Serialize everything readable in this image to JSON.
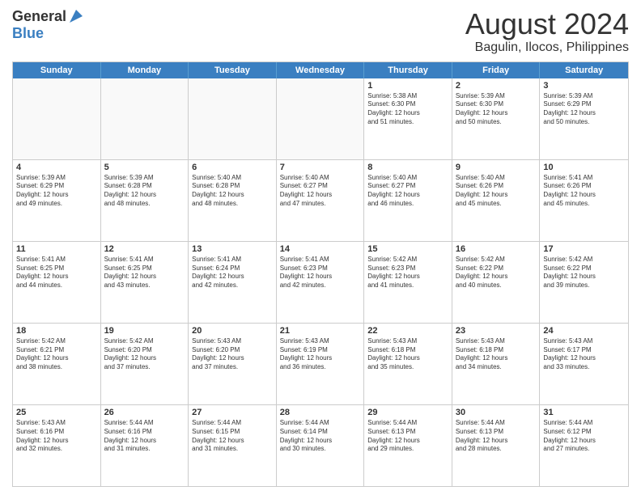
{
  "logo": {
    "line1": "General",
    "line2": "Blue"
  },
  "title": "August 2024",
  "subtitle": "Bagulin, Ilocos, Philippines",
  "days": [
    "Sunday",
    "Monday",
    "Tuesday",
    "Wednesday",
    "Thursday",
    "Friday",
    "Saturday"
  ],
  "weeks": [
    [
      {
        "day": "",
        "text": ""
      },
      {
        "day": "",
        "text": ""
      },
      {
        "day": "",
        "text": ""
      },
      {
        "day": "",
        "text": ""
      },
      {
        "day": "1",
        "text": "Sunrise: 5:38 AM\nSunset: 6:30 PM\nDaylight: 12 hours\nand 51 minutes."
      },
      {
        "day": "2",
        "text": "Sunrise: 5:39 AM\nSunset: 6:30 PM\nDaylight: 12 hours\nand 50 minutes."
      },
      {
        "day": "3",
        "text": "Sunrise: 5:39 AM\nSunset: 6:29 PM\nDaylight: 12 hours\nand 50 minutes."
      }
    ],
    [
      {
        "day": "4",
        "text": "Sunrise: 5:39 AM\nSunset: 6:29 PM\nDaylight: 12 hours\nand 49 minutes."
      },
      {
        "day": "5",
        "text": "Sunrise: 5:39 AM\nSunset: 6:28 PM\nDaylight: 12 hours\nand 48 minutes."
      },
      {
        "day": "6",
        "text": "Sunrise: 5:40 AM\nSunset: 6:28 PM\nDaylight: 12 hours\nand 48 minutes."
      },
      {
        "day": "7",
        "text": "Sunrise: 5:40 AM\nSunset: 6:27 PM\nDaylight: 12 hours\nand 47 minutes."
      },
      {
        "day": "8",
        "text": "Sunrise: 5:40 AM\nSunset: 6:27 PM\nDaylight: 12 hours\nand 46 minutes."
      },
      {
        "day": "9",
        "text": "Sunrise: 5:40 AM\nSunset: 6:26 PM\nDaylight: 12 hours\nand 45 minutes."
      },
      {
        "day": "10",
        "text": "Sunrise: 5:41 AM\nSunset: 6:26 PM\nDaylight: 12 hours\nand 45 minutes."
      }
    ],
    [
      {
        "day": "11",
        "text": "Sunrise: 5:41 AM\nSunset: 6:25 PM\nDaylight: 12 hours\nand 44 minutes."
      },
      {
        "day": "12",
        "text": "Sunrise: 5:41 AM\nSunset: 6:25 PM\nDaylight: 12 hours\nand 43 minutes."
      },
      {
        "day": "13",
        "text": "Sunrise: 5:41 AM\nSunset: 6:24 PM\nDaylight: 12 hours\nand 42 minutes."
      },
      {
        "day": "14",
        "text": "Sunrise: 5:41 AM\nSunset: 6:23 PM\nDaylight: 12 hours\nand 42 minutes."
      },
      {
        "day": "15",
        "text": "Sunrise: 5:42 AM\nSunset: 6:23 PM\nDaylight: 12 hours\nand 41 minutes."
      },
      {
        "day": "16",
        "text": "Sunrise: 5:42 AM\nSunset: 6:22 PM\nDaylight: 12 hours\nand 40 minutes."
      },
      {
        "day": "17",
        "text": "Sunrise: 5:42 AM\nSunset: 6:22 PM\nDaylight: 12 hours\nand 39 minutes."
      }
    ],
    [
      {
        "day": "18",
        "text": "Sunrise: 5:42 AM\nSunset: 6:21 PM\nDaylight: 12 hours\nand 38 minutes."
      },
      {
        "day": "19",
        "text": "Sunrise: 5:42 AM\nSunset: 6:20 PM\nDaylight: 12 hours\nand 37 minutes."
      },
      {
        "day": "20",
        "text": "Sunrise: 5:43 AM\nSunset: 6:20 PM\nDaylight: 12 hours\nand 37 minutes."
      },
      {
        "day": "21",
        "text": "Sunrise: 5:43 AM\nSunset: 6:19 PM\nDaylight: 12 hours\nand 36 minutes."
      },
      {
        "day": "22",
        "text": "Sunrise: 5:43 AM\nSunset: 6:18 PM\nDaylight: 12 hours\nand 35 minutes."
      },
      {
        "day": "23",
        "text": "Sunrise: 5:43 AM\nSunset: 6:18 PM\nDaylight: 12 hours\nand 34 minutes."
      },
      {
        "day": "24",
        "text": "Sunrise: 5:43 AM\nSunset: 6:17 PM\nDaylight: 12 hours\nand 33 minutes."
      }
    ],
    [
      {
        "day": "25",
        "text": "Sunrise: 5:43 AM\nSunset: 6:16 PM\nDaylight: 12 hours\nand 32 minutes."
      },
      {
        "day": "26",
        "text": "Sunrise: 5:44 AM\nSunset: 6:16 PM\nDaylight: 12 hours\nand 31 minutes."
      },
      {
        "day": "27",
        "text": "Sunrise: 5:44 AM\nSunset: 6:15 PM\nDaylight: 12 hours\nand 31 minutes."
      },
      {
        "day": "28",
        "text": "Sunrise: 5:44 AM\nSunset: 6:14 PM\nDaylight: 12 hours\nand 30 minutes."
      },
      {
        "day": "29",
        "text": "Sunrise: 5:44 AM\nSunset: 6:13 PM\nDaylight: 12 hours\nand 29 minutes."
      },
      {
        "day": "30",
        "text": "Sunrise: 5:44 AM\nSunset: 6:13 PM\nDaylight: 12 hours\nand 28 minutes."
      },
      {
        "day": "31",
        "text": "Sunrise: 5:44 AM\nSunset: 6:12 PM\nDaylight: 12 hours\nand 27 minutes."
      }
    ]
  ]
}
